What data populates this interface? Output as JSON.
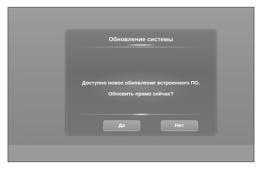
{
  "dialog": {
    "title": "Обновление системы",
    "message_line1": "Доступно новое обновление встроенного ПО.",
    "message_line2": "Обновить прямо сейчас?",
    "buttons": {
      "yes": "Да",
      "no": "Нет"
    }
  },
  "colors": {
    "screen_bg": "#929292",
    "dialog_bg": "#737373",
    "text": "#ffffff",
    "button_bg": "#9e9e9e"
  }
}
